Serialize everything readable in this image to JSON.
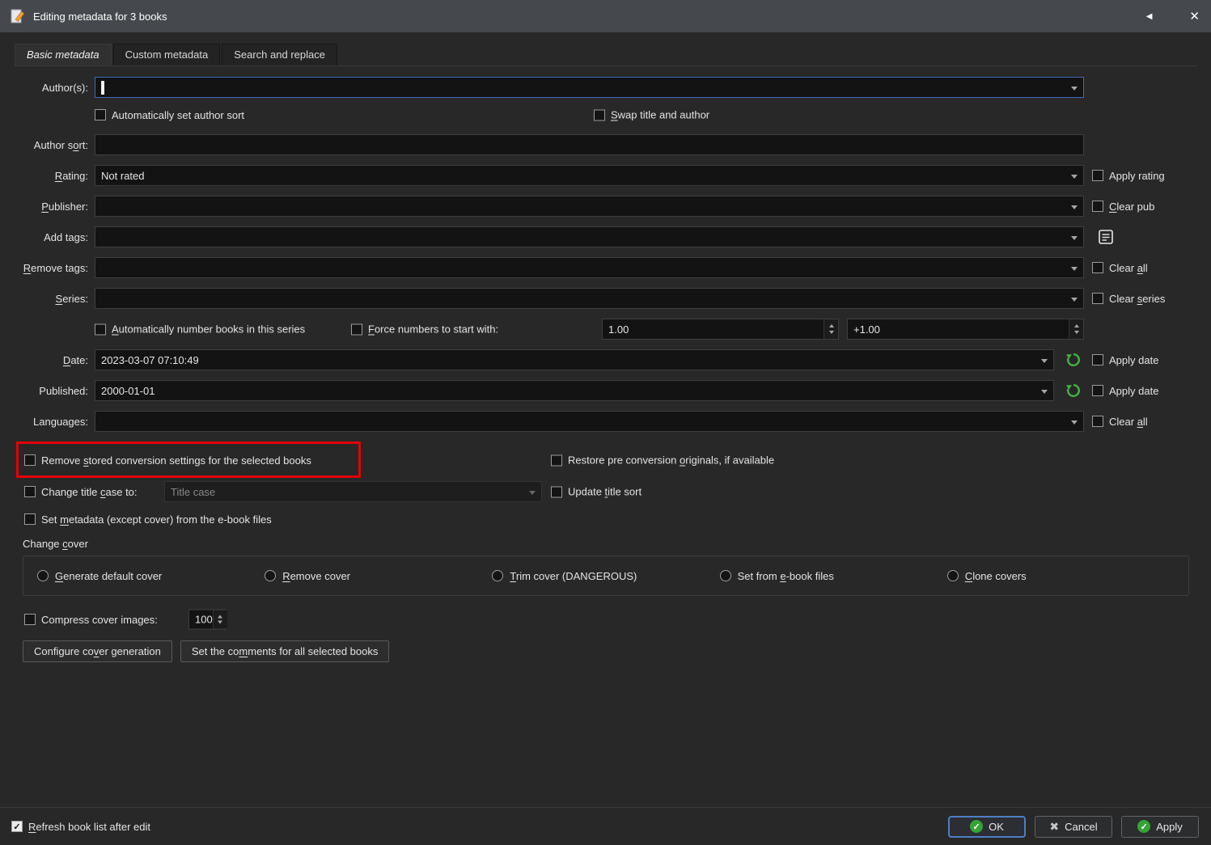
{
  "window": {
    "title": "Editing metadata for 3 books"
  },
  "icons": {
    "collapse": "◀",
    "close": "✕",
    "check": "✓",
    "cancel_x": "✖"
  },
  "tabs": {
    "basic": "Basic metadata",
    "custom": "Custom metadata",
    "search": "Search and replace"
  },
  "form": {
    "authors_label": "Author(s):",
    "auto_author_sort": "Automatically set author sort",
    "swap_title_author": "&Swap title and author",
    "author_sort_label": "Author s&ort:",
    "rating_label": "&Rating:",
    "rating_value": "Not rated",
    "apply_rating": "Apply rating",
    "publisher_label": "&Publisher:",
    "clear_pub": "&Clear pub",
    "add_tags_label": "Add tags:",
    "remove_tags_label": "&Remove tags:",
    "clear_all_tags": "Clear &all",
    "series_label": "&Series:",
    "clear_series": "Clear &series",
    "autonumber_series": "&Automatically number books in this series",
    "force_numbers": "&Force numbers to start with:",
    "series_start": "1.00",
    "series_increment": "+1.00",
    "date_label": "&Date:",
    "date_value": "2023-03-07 07:10:49",
    "apply_date": "Apply date",
    "published_label": "Published:",
    "published_value": "2000-01-01",
    "apply_published": "Apply date",
    "languages_label": "Languages:",
    "clear_all_languages": "Clear &all",
    "remove_conversion": "Remove &stored conversion settings for the selected books",
    "restore_originals": "Restore pre conversion &originals, if available",
    "change_title_case": "Change title &case to:",
    "title_case_value": "Title case",
    "update_title_sort": "Update &title sort",
    "set_metadata": "Set &metadata (except cover) from the e-book files",
    "change_cover_label": "Change &cover",
    "cover_options": [
      "&Generate default cover",
      "&Remove cover",
      "&Trim cover (DANGEROUS)",
      "Set from &e-book files",
      "&Clone covers"
    ],
    "compress_label": "Compress cover images:",
    "compress_value": "100",
    "configure_cover_btn": "Configure co&ver generation",
    "set_comments_btn": "Set the co&mments for all selected books"
  },
  "footer": {
    "refresh_label": "&Refresh book list after edit",
    "ok": "OK",
    "cancel": "Cancel",
    "apply": "Apply"
  }
}
